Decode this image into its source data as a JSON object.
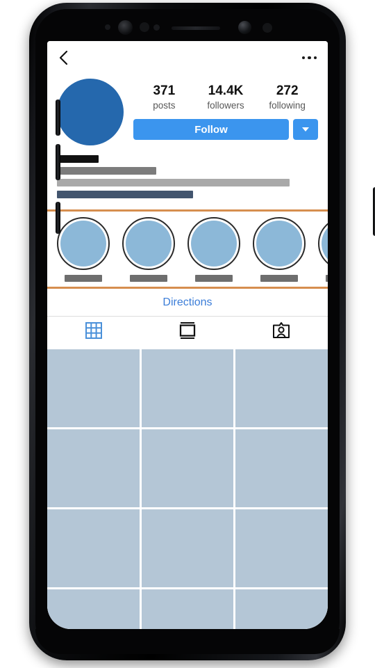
{
  "device": {
    "frame_color": "#000000",
    "sensors": [
      "proximity-dot",
      "iris-scanner",
      "sensor-dot",
      "sensor-dot-small",
      "speaker-grille",
      "front-camera",
      "sensor-dot"
    ],
    "buttons": [
      "volume-up",
      "volume-down",
      "bixby",
      "power"
    ]
  },
  "navbar": {
    "back_icon": "chevron-left-icon",
    "more_icon": "more-horizontal-icon"
  },
  "profile": {
    "avatar_color": "#2568ad",
    "stats": [
      {
        "value": "371",
        "label": "posts"
      },
      {
        "value": "14.4K",
        "label": "followers"
      },
      {
        "value": "272",
        "label": "following"
      }
    ],
    "follow_label": "Follow",
    "follow_color": "#3b95ee",
    "dropdown_icon": "chevron-down-icon"
  },
  "bio_bars": [
    {
      "color": "#111111",
      "width": "16%"
    },
    {
      "color": "#7c7c7c",
      "width": "38%"
    },
    {
      "color": "#a9a9a9",
      "width": "89%"
    },
    {
      "color": "#42556e",
      "width": "52%"
    }
  ],
  "dividers": {
    "color": "#d68e4f"
  },
  "highlights": [
    {
      "ring_color": "#2a2a2a",
      "fill_color": "#8cb8d8",
      "label_color": "#6e6e6e"
    },
    {
      "ring_color": "#2a2a2a",
      "fill_color": "#8cb8d8",
      "label_color": "#6e6e6e"
    },
    {
      "ring_color": "#2a2a2a",
      "fill_color": "#8cb8d8",
      "label_color": "#6e6e6e"
    },
    {
      "ring_color": "#2a2a2a",
      "fill_color": "#8cb8d8",
      "label_color": "#6e6e6e"
    },
    {
      "ring_color": "#2a2a2a",
      "fill_color": "#8cb8d8",
      "label_color": "#6e6e6e"
    }
  ],
  "directions": {
    "label": "Directions",
    "color": "#3b7dd8"
  },
  "tabs": [
    {
      "icon": "grid-icon",
      "name": "posts-grid",
      "active": true,
      "color": "#4a90d9"
    },
    {
      "icon": "igtv-icon",
      "name": "igtv",
      "active": false,
      "color": "#111111"
    },
    {
      "icon": "tagged-icon",
      "name": "tagged",
      "active": false,
      "color": "#111111"
    }
  ],
  "photo_grid": {
    "tile_color": "#b4c6d6",
    "columns": 3,
    "tiles": [
      1,
      2,
      3,
      4,
      5,
      6,
      7,
      8,
      9,
      10,
      11,
      12
    ]
  }
}
